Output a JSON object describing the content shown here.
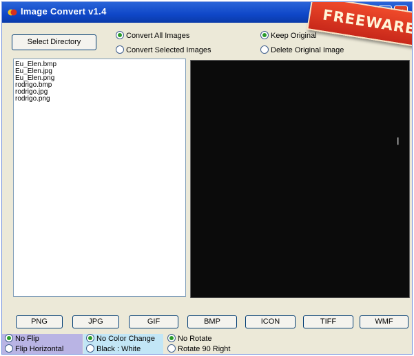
{
  "window": {
    "title": "Image Convert v1.4",
    "badge": "FREEWARE",
    "minimize_glyph": "_",
    "maximize_glyph": "□",
    "close_glyph": "✕"
  },
  "toolbar": {
    "select_directory": "Select Directory",
    "convert_all": "Convert All Images",
    "convert_selected": "Convert Selected Images",
    "keep_original": "Keep Original",
    "delete_original": "Delete Original Image"
  },
  "files": [
    "Eu_Elen.bmp",
    "Eu_Elen.jpg",
    "Eu_Elen.png",
    "rodrigo.bmp",
    "rodrigo.jpg",
    "rodrigo.png"
  ],
  "formats": [
    "PNG",
    "JPG",
    "GIF",
    "BMP",
    "ICON",
    "TIFF",
    "WMF"
  ],
  "flip": {
    "no_flip": "No Flip",
    "flip_horizontal": "Flip Horizontal"
  },
  "color": {
    "no_color_change": "No Color Change",
    "black_white": "Black : White"
  },
  "rotate": {
    "no_rotate": "No Rotate",
    "rotate_90_right": "Rotate 90 Right"
  },
  "colors": {
    "title_bar": "#0f47c8",
    "flip_panel": "#b9b4e4",
    "color_panel": "#c2e6f6",
    "badge": "#d9432b"
  },
  "icons": [
    "app-icon",
    "minimize-icon",
    "maximize-icon",
    "close-icon"
  ]
}
